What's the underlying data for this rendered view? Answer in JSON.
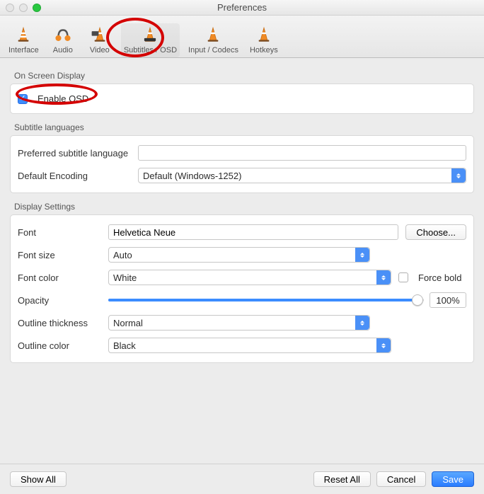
{
  "window": {
    "title": "Preferences"
  },
  "toolbar": {
    "items": [
      {
        "label": "Interface"
      },
      {
        "label": "Audio"
      },
      {
        "label": "Video"
      },
      {
        "label": "Subtitles / OSD"
      },
      {
        "label": "Input / Codecs"
      },
      {
        "label": "Hotkeys"
      }
    ]
  },
  "osd": {
    "group_label": "On Screen Display",
    "enable_label": "Enable OSD",
    "enabled": true
  },
  "subs": {
    "group_label": "Subtitle languages",
    "pref_lang_label": "Preferred subtitle language",
    "pref_lang_value": "",
    "encoding_label": "Default Encoding",
    "encoding_value": "Default (Windows-1252)"
  },
  "display": {
    "group_label": "Display Settings",
    "font_label": "Font",
    "font_value": "Helvetica Neue",
    "choose_label": "Choose...",
    "fontsize_label": "Font size",
    "fontsize_value": "Auto",
    "fontcolor_label": "Font color",
    "fontcolor_value": "White",
    "forcebold_label": "Force bold",
    "opacity_label": "Opacity",
    "opacity_value": "100%",
    "opacity_pct": 100,
    "thick_label": "Outline thickness",
    "thick_value": "Normal",
    "outcolor_label": "Outline color",
    "outcolor_value": "Black"
  },
  "footer": {
    "showall": "Show All",
    "resetall": "Reset All",
    "cancel": "Cancel",
    "save": "Save"
  }
}
